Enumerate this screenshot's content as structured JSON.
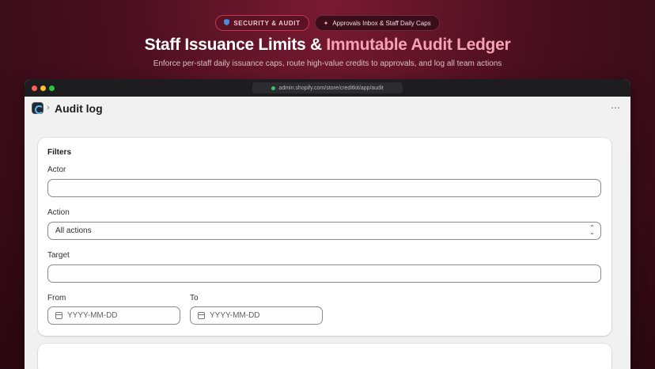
{
  "hero": {
    "badge_security": "SECURITY & AUDIT",
    "badge_feature": "Approvals Inbox & Staff Daily Caps",
    "title_main": "Staff Issuance Limits & ",
    "title_accent": "Immutable Audit Ledger",
    "subtitle": "Enforce per-staff daily issuance caps, route high-value credits to approvals, and log all team actions"
  },
  "browser": {
    "url": "admin.shopify.com/store/creditkit/app/audit"
  },
  "app": {
    "breadcrumb_separator": "›",
    "page_title": "Audit log",
    "more_icon": "⋯"
  },
  "filters": {
    "title": "Filters",
    "actor_label": "Actor",
    "actor_value": "",
    "action_label": "Action",
    "action_selected": "All actions",
    "target_label": "Target",
    "target_value": "",
    "from_label": "From",
    "from_placeholder": "YYYY-MM-DD",
    "to_label": "To",
    "to_placeholder": "YYYY-MM-DD"
  },
  "colors": {
    "accent_pink": "#f7a2b4",
    "background_dark": "#4a0f1f"
  }
}
